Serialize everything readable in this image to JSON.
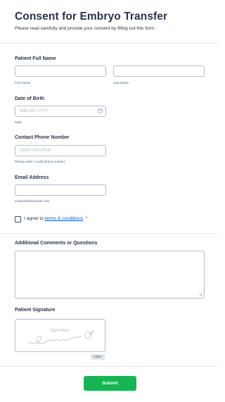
{
  "header": {
    "title": "Consent for Embryo Transfer",
    "subtitle": "Please read carefully and provide your consent by filling out this form."
  },
  "patient_name": {
    "label": "Patient Full Name",
    "first_name": {
      "value": "",
      "sublabel": "First Name"
    },
    "last_name": {
      "value": "",
      "sublabel": "Last Name"
    }
  },
  "dob": {
    "label": "Date of Birth",
    "placeholder": "MM-DD-YYYY",
    "sublabel": "Date",
    "icon": "calendar-icon"
  },
  "phone": {
    "label": "Contact Phone Number",
    "placeholder": "(000) 000-0000",
    "sublabel": "Please enter a valid phone number."
  },
  "email": {
    "label": "Email Address",
    "value": "",
    "sublabel": "example@example.com"
  },
  "consent": {
    "prefix": "I agree to ",
    "link": "terms & conditions",
    "suffix": ".",
    "required_mark": "*",
    "checked": false
  },
  "comments": {
    "label": "Additional Comments or Questions",
    "value": ""
  },
  "signature": {
    "label": "Patient Signature",
    "placeholder": "Sign Here",
    "clear_label": "Clear",
    "icon": "pen-icon"
  },
  "submit_label": "Submit",
  "colors": {
    "accent": "#18b453",
    "link": "#0b57d0",
    "required": "#e23b3b",
    "text": "#2c3345",
    "border": "#b8bdc9"
  }
}
